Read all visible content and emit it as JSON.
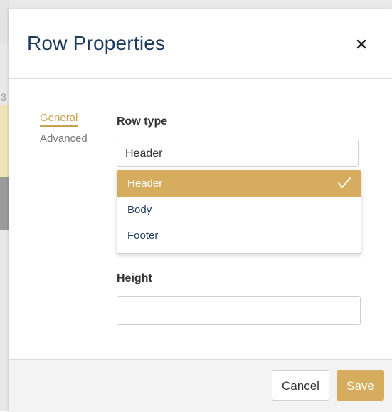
{
  "dialog": {
    "title": "Row Properties",
    "close_icon": "close-icon"
  },
  "sidebar": {
    "items": [
      {
        "label": "General",
        "active": true
      },
      {
        "label": "Advanced",
        "active": false
      }
    ]
  },
  "form": {
    "row_type": {
      "label": "Row type",
      "value": "Header",
      "options": [
        {
          "label": "Header",
          "selected": true
        },
        {
          "label": "Body",
          "selected": false
        },
        {
          "label": "Footer",
          "selected": false
        }
      ]
    },
    "height": {
      "label": "Height",
      "value": ""
    }
  },
  "footer": {
    "cancel_label": "Cancel",
    "save_label": "Save"
  },
  "colors": {
    "accent": "#d6ad5e",
    "title": "#1e3a5f",
    "active_tab": "#c9a24f"
  },
  "backdrop": {
    "edge_char": "3"
  }
}
